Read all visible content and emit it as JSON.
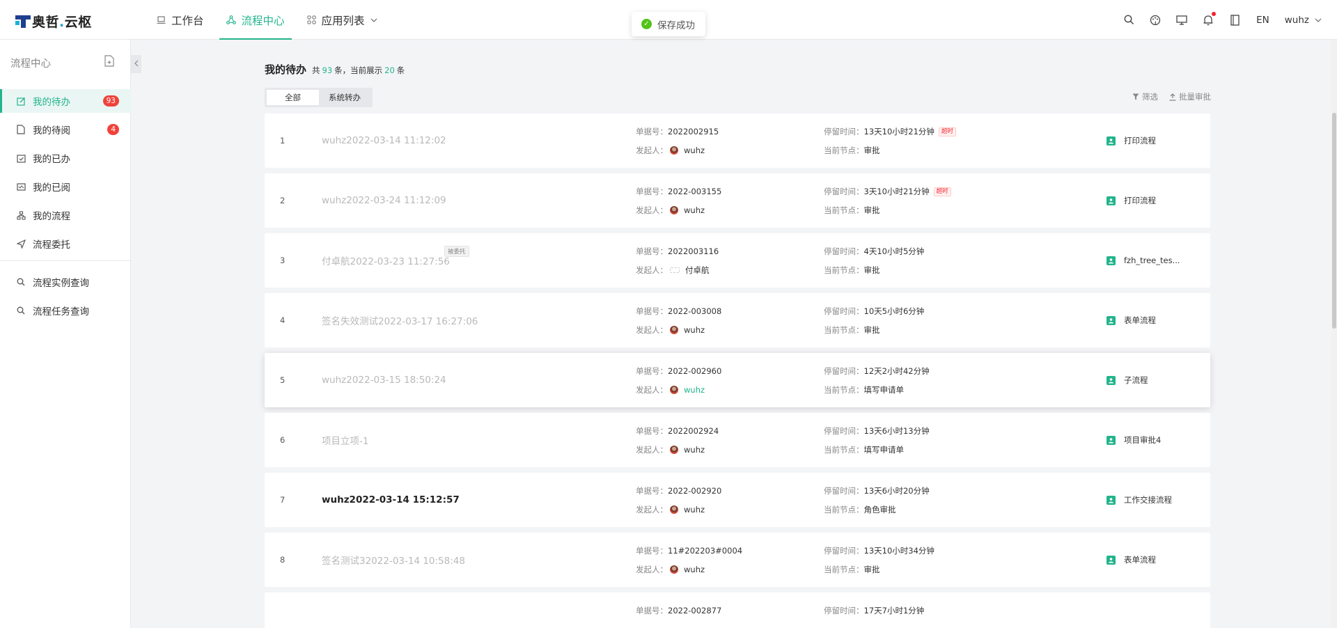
{
  "header": {
    "logo": {
      "main": "奥哲",
      "dot": ".",
      "sub": "云枢"
    },
    "nav": [
      {
        "label": "工作台",
        "icon": "laptop-icon"
      },
      {
        "label": "流程中心",
        "icon": "flow-icon",
        "active": true
      },
      {
        "label": "应用列表",
        "icon": "grid-icon",
        "dropdown": true
      }
    ],
    "toast": "保存成功",
    "right": {
      "lang": "EN",
      "user": "wuhz"
    }
  },
  "sidebar": {
    "title": "流程中心",
    "items": [
      {
        "label": "我的待办",
        "icon": "edit-icon",
        "badge": "93",
        "active": true
      },
      {
        "label": "我的待阅",
        "icon": "file-icon",
        "badge": "4"
      },
      {
        "label": "我的已办",
        "icon": "check-calendar-icon"
      },
      {
        "label": "我的已阅",
        "icon": "read-icon"
      },
      {
        "label": "我的流程",
        "icon": "org-icon"
      },
      {
        "label": "流程委托",
        "icon": "send-icon"
      }
    ],
    "queries": [
      {
        "label": "流程实例查询",
        "icon": "search-icon"
      },
      {
        "label": "流程任务查询",
        "icon": "search-icon"
      }
    ]
  },
  "main": {
    "title": "我的待办",
    "count": {
      "prefix": "共",
      "total": "93",
      "mid": "条，当前展示",
      "shown": "20",
      "suffix": "条"
    },
    "tabs": [
      "全部",
      "系统转办"
    ],
    "actions": {
      "filter": "筛选",
      "batch": "批量审批"
    },
    "labels": {
      "num": "单据号：",
      "initiator": "发起人：",
      "stay": "停留时间：",
      "node": "当前节点：",
      "overdue": "超时",
      "delegated": "被委托"
    },
    "rows": [
      {
        "index": "1",
        "title": "wuhz2022-03-14 11:12:02",
        "num": "2022002915",
        "initiator": "wuhz",
        "stay": "13天10小时21分钟",
        "overdue": true,
        "node": "审批",
        "process": "打印流程"
      },
      {
        "index": "2",
        "title": "wuhz2022-03-24 11:12:09",
        "num": "2022-003155",
        "initiator": "wuhz",
        "stay": "3天10小时21分钟",
        "overdue": true,
        "node": "审批",
        "process": "打印流程"
      },
      {
        "index": "3",
        "title": "付卓航2022-03-23 11:27:56",
        "delegated": true,
        "num": "2022003116",
        "initiator": "付卓航",
        "avatarBroken": true,
        "stay": "4天10小时5分钟",
        "node": "审批",
        "process": "fzh_tree_tes..."
      },
      {
        "index": "4",
        "title": "签名失效测试2022-03-17 16:27:06",
        "num": "2022-003008",
        "initiator": "wuhz",
        "stay": "10天5小时6分钟",
        "node": "审批",
        "process": "表单流程"
      },
      {
        "index": "5",
        "title": "wuhz2022-03-15 18:50:24",
        "num": "2022-002960",
        "initiator": "wuhz",
        "initiatorLink": true,
        "stay": "12天2小时42分钟",
        "node": "填写申请单",
        "process": "子流程",
        "hover": true
      },
      {
        "index": "6",
        "title": "项目立项-1",
        "num": "2022002924",
        "initiator": "wuhz",
        "stay": "13天6小时13分钟",
        "node": "填写申请单",
        "process": "项目审批4"
      },
      {
        "index": "7",
        "title": "wuhz2022-03-14 15:12:57",
        "unread": true,
        "num": "2022-002920",
        "initiator": "wuhz",
        "stay": "13天6小时20分钟",
        "node": "角色审批",
        "process": "工作交接流程"
      },
      {
        "index": "8",
        "title": "签名测试32022-03-14 10:58:48",
        "num": "11#202203#0004",
        "initiator": "wuhz",
        "stay": "13天10小时34分钟",
        "node": "审批",
        "process": "表单流程"
      },
      {
        "index": "",
        "title": "",
        "num": "2022-002877",
        "initiator": "",
        "stay": "17天7小时1分钟",
        "node": "",
        "process": ""
      }
    ]
  }
}
